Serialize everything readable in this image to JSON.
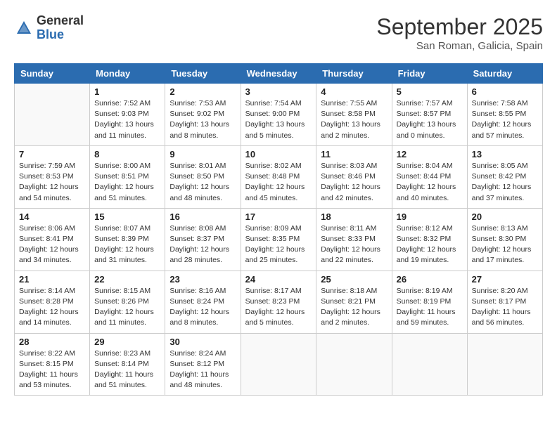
{
  "header": {
    "logo_general": "General",
    "logo_blue": "Blue",
    "month_title": "September 2025",
    "location": "San Roman, Galicia, Spain"
  },
  "columns": [
    "Sunday",
    "Monday",
    "Tuesday",
    "Wednesday",
    "Thursday",
    "Friday",
    "Saturday"
  ],
  "weeks": [
    [
      {
        "num": "",
        "info": ""
      },
      {
        "num": "1",
        "info": "Sunrise: 7:52 AM\nSunset: 9:03 PM\nDaylight: 13 hours\nand 11 minutes."
      },
      {
        "num": "2",
        "info": "Sunrise: 7:53 AM\nSunset: 9:02 PM\nDaylight: 13 hours\nand 8 minutes."
      },
      {
        "num": "3",
        "info": "Sunrise: 7:54 AM\nSunset: 9:00 PM\nDaylight: 13 hours\nand 5 minutes."
      },
      {
        "num": "4",
        "info": "Sunrise: 7:55 AM\nSunset: 8:58 PM\nDaylight: 13 hours\nand 2 minutes."
      },
      {
        "num": "5",
        "info": "Sunrise: 7:57 AM\nSunset: 8:57 PM\nDaylight: 13 hours\nand 0 minutes."
      },
      {
        "num": "6",
        "info": "Sunrise: 7:58 AM\nSunset: 8:55 PM\nDaylight: 12 hours\nand 57 minutes."
      }
    ],
    [
      {
        "num": "7",
        "info": "Sunrise: 7:59 AM\nSunset: 8:53 PM\nDaylight: 12 hours\nand 54 minutes."
      },
      {
        "num": "8",
        "info": "Sunrise: 8:00 AM\nSunset: 8:51 PM\nDaylight: 12 hours\nand 51 minutes."
      },
      {
        "num": "9",
        "info": "Sunrise: 8:01 AM\nSunset: 8:50 PM\nDaylight: 12 hours\nand 48 minutes."
      },
      {
        "num": "10",
        "info": "Sunrise: 8:02 AM\nSunset: 8:48 PM\nDaylight: 12 hours\nand 45 minutes."
      },
      {
        "num": "11",
        "info": "Sunrise: 8:03 AM\nSunset: 8:46 PM\nDaylight: 12 hours\nand 42 minutes."
      },
      {
        "num": "12",
        "info": "Sunrise: 8:04 AM\nSunset: 8:44 PM\nDaylight: 12 hours\nand 40 minutes."
      },
      {
        "num": "13",
        "info": "Sunrise: 8:05 AM\nSunset: 8:42 PM\nDaylight: 12 hours\nand 37 minutes."
      }
    ],
    [
      {
        "num": "14",
        "info": "Sunrise: 8:06 AM\nSunset: 8:41 PM\nDaylight: 12 hours\nand 34 minutes."
      },
      {
        "num": "15",
        "info": "Sunrise: 8:07 AM\nSunset: 8:39 PM\nDaylight: 12 hours\nand 31 minutes."
      },
      {
        "num": "16",
        "info": "Sunrise: 8:08 AM\nSunset: 8:37 PM\nDaylight: 12 hours\nand 28 minutes."
      },
      {
        "num": "17",
        "info": "Sunrise: 8:09 AM\nSunset: 8:35 PM\nDaylight: 12 hours\nand 25 minutes."
      },
      {
        "num": "18",
        "info": "Sunrise: 8:11 AM\nSunset: 8:33 PM\nDaylight: 12 hours\nand 22 minutes."
      },
      {
        "num": "19",
        "info": "Sunrise: 8:12 AM\nSunset: 8:32 PM\nDaylight: 12 hours\nand 19 minutes."
      },
      {
        "num": "20",
        "info": "Sunrise: 8:13 AM\nSunset: 8:30 PM\nDaylight: 12 hours\nand 17 minutes."
      }
    ],
    [
      {
        "num": "21",
        "info": "Sunrise: 8:14 AM\nSunset: 8:28 PM\nDaylight: 12 hours\nand 14 minutes."
      },
      {
        "num": "22",
        "info": "Sunrise: 8:15 AM\nSunset: 8:26 PM\nDaylight: 12 hours\nand 11 minutes."
      },
      {
        "num": "23",
        "info": "Sunrise: 8:16 AM\nSunset: 8:24 PM\nDaylight: 12 hours\nand 8 minutes."
      },
      {
        "num": "24",
        "info": "Sunrise: 8:17 AM\nSunset: 8:23 PM\nDaylight: 12 hours\nand 5 minutes."
      },
      {
        "num": "25",
        "info": "Sunrise: 8:18 AM\nSunset: 8:21 PM\nDaylight: 12 hours\nand 2 minutes."
      },
      {
        "num": "26",
        "info": "Sunrise: 8:19 AM\nSunset: 8:19 PM\nDaylight: 11 hours\nand 59 minutes."
      },
      {
        "num": "27",
        "info": "Sunrise: 8:20 AM\nSunset: 8:17 PM\nDaylight: 11 hours\nand 56 minutes."
      }
    ],
    [
      {
        "num": "28",
        "info": "Sunrise: 8:22 AM\nSunset: 8:15 PM\nDaylight: 11 hours\nand 53 minutes."
      },
      {
        "num": "29",
        "info": "Sunrise: 8:23 AM\nSunset: 8:14 PM\nDaylight: 11 hours\nand 51 minutes."
      },
      {
        "num": "30",
        "info": "Sunrise: 8:24 AM\nSunset: 8:12 PM\nDaylight: 11 hours\nand 48 minutes."
      },
      {
        "num": "",
        "info": ""
      },
      {
        "num": "",
        "info": ""
      },
      {
        "num": "",
        "info": ""
      },
      {
        "num": "",
        "info": ""
      }
    ]
  ]
}
